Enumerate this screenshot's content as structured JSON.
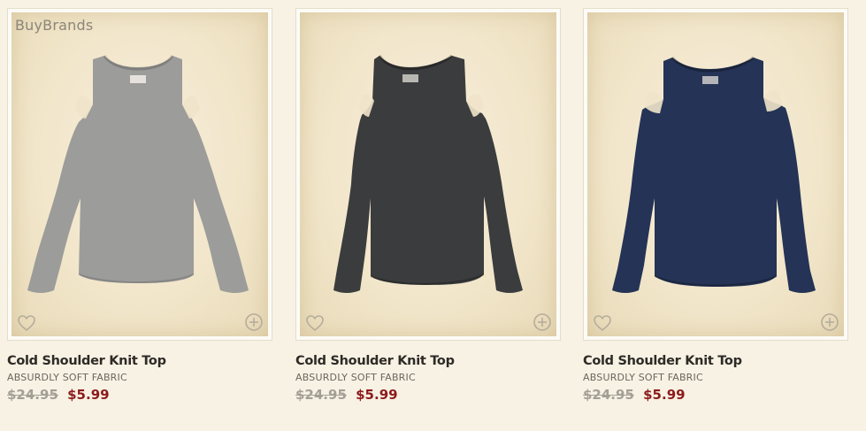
{
  "watermark": "BuyBrands",
  "products": [
    {
      "name": "Cold Shoulder Knit Top",
      "subtitle": "ABSURDLY SOFT FABRIC",
      "original_price": "$24.95",
      "sale_price": "$5.99",
      "color": "#9c9c9a"
    },
    {
      "name": "Cold Shoulder Knit Top",
      "subtitle": "ABSURDLY SOFT FABRIC",
      "original_price": "$24.95",
      "sale_price": "$5.99",
      "color": "#3b3c3d"
    },
    {
      "name": "Cold Shoulder Knit Top",
      "subtitle": "ABSURDLY SOFT FABRIC",
      "original_price": "$24.95",
      "sale_price": "$5.99",
      "color": "#253356"
    }
  ],
  "icons": {
    "wishlist": "heart-icon",
    "add": "plus-circle-icon"
  }
}
